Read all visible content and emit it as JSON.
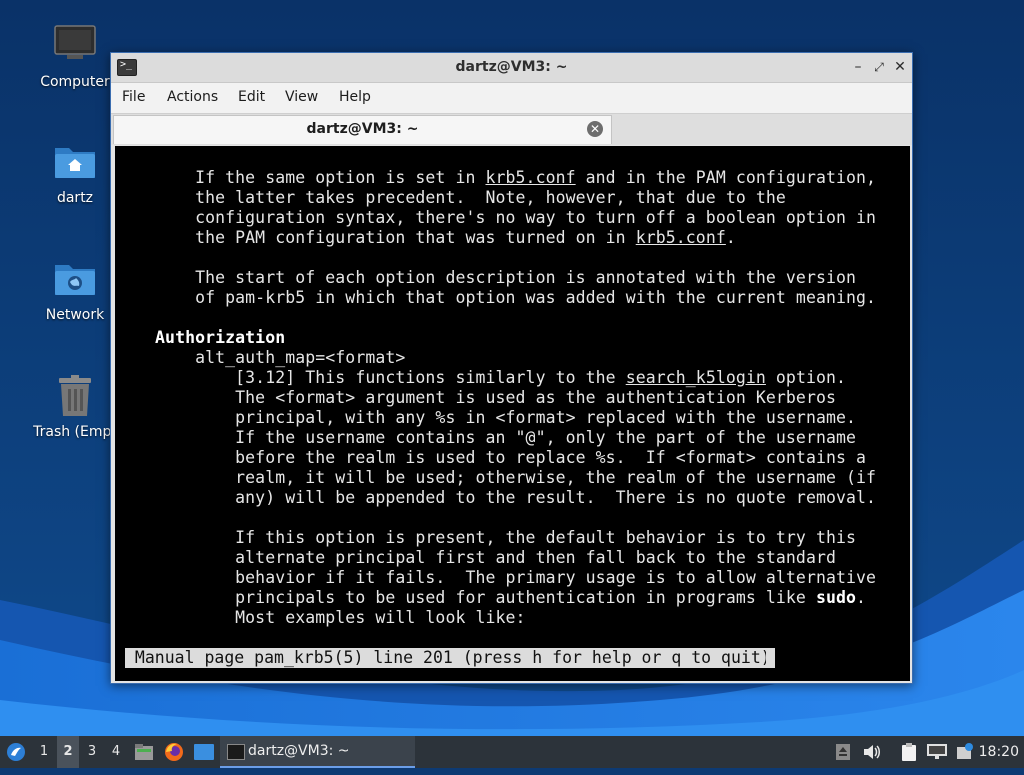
{
  "desktop": {
    "icons": [
      {
        "label": "Computer"
      },
      {
        "label": "dartz"
      },
      {
        "label": "Network"
      },
      {
        "label": "Trash (Empt"
      }
    ]
  },
  "window": {
    "title": "dartz@VM3: ~",
    "controls": {
      "minimize": "–",
      "maximize": "⤢",
      "close": "✕"
    },
    "menu": [
      "File",
      "Actions",
      "Edit",
      "View",
      "Help"
    ],
    "tab": {
      "label": "dartz@VM3: ~",
      "close": "✕"
    }
  },
  "terminal": {
    "lines": [
      [
        {
          "t": "       If the same option is set in "
        },
        {
          "t": "krb5.conf",
          "u": true
        },
        {
          "t": " and in the PAM configuration,"
        }
      ],
      [
        {
          "t": "       the latter takes precedent.  Note, however, that due to the"
        }
      ],
      [
        {
          "t": "       configuration syntax, there's no way to turn off a boolean option in"
        }
      ],
      [
        {
          "t": "       the PAM configuration that was turned on in "
        },
        {
          "t": "krb5.conf",
          "u": true
        },
        {
          "t": "."
        }
      ],
      [
        {
          "t": ""
        }
      ],
      [
        {
          "t": "       The start of each option description is annotated with the version"
        }
      ],
      [
        {
          "t": "       of pam-krb5 in which that option was added with the current meaning."
        }
      ],
      [
        {
          "t": ""
        }
      ],
      [
        {
          "t": "   "
        },
        {
          "t": "Authorization",
          "b": true
        }
      ],
      [
        {
          "t": "       alt_auth_map=<format>"
        }
      ],
      [
        {
          "t": "           [3.12] This functions similarly to the "
        },
        {
          "t": "search_k5login",
          "u": true
        },
        {
          "t": " option."
        }
      ],
      [
        {
          "t": "           The <format> argument is used as the authentication Kerberos"
        }
      ],
      [
        {
          "t": "           principal, with any %s in <format> replaced with the username."
        }
      ],
      [
        {
          "t": "           If the username contains an \"@\", only the part of the username"
        }
      ],
      [
        {
          "t": "           before the realm is used to replace %s.  If <format> contains a"
        }
      ],
      [
        {
          "t": "           realm, it will be used; otherwise, the realm of the username (if"
        }
      ],
      [
        {
          "t": "           any) will be appended to the result.  There is no quote removal."
        }
      ],
      [
        {
          "t": ""
        }
      ],
      [
        {
          "t": "           If this option is present, the default behavior is to try this"
        }
      ],
      [
        {
          "t": "           alternate principal first and then fall back to the standard"
        }
      ],
      [
        {
          "t": "           behavior if it fails.  The primary usage is to allow alternative"
        }
      ],
      [
        {
          "t": "           principals to be used for authentication in programs like "
        },
        {
          "t": "sudo",
          "b": true
        },
        {
          "t": "."
        }
      ],
      [
        {
          "t": "           Most examples will look like:"
        }
      ]
    ],
    "status": " Manual page pam_krb5(5) line 201 (press h for help or q to quit)"
  },
  "taskbar": {
    "workspaces": [
      "1",
      "2",
      "3",
      "4"
    ],
    "active_workspace": "2",
    "task_label": "dartz@VM3: ~",
    "clock": "18:20"
  },
  "colors": {
    "wallpaper_dark": "#0d3a73",
    "wallpaper_wave": "#1e73d6",
    "taskbar": "#2c333a",
    "folder_blue": "#3d8fd6"
  }
}
